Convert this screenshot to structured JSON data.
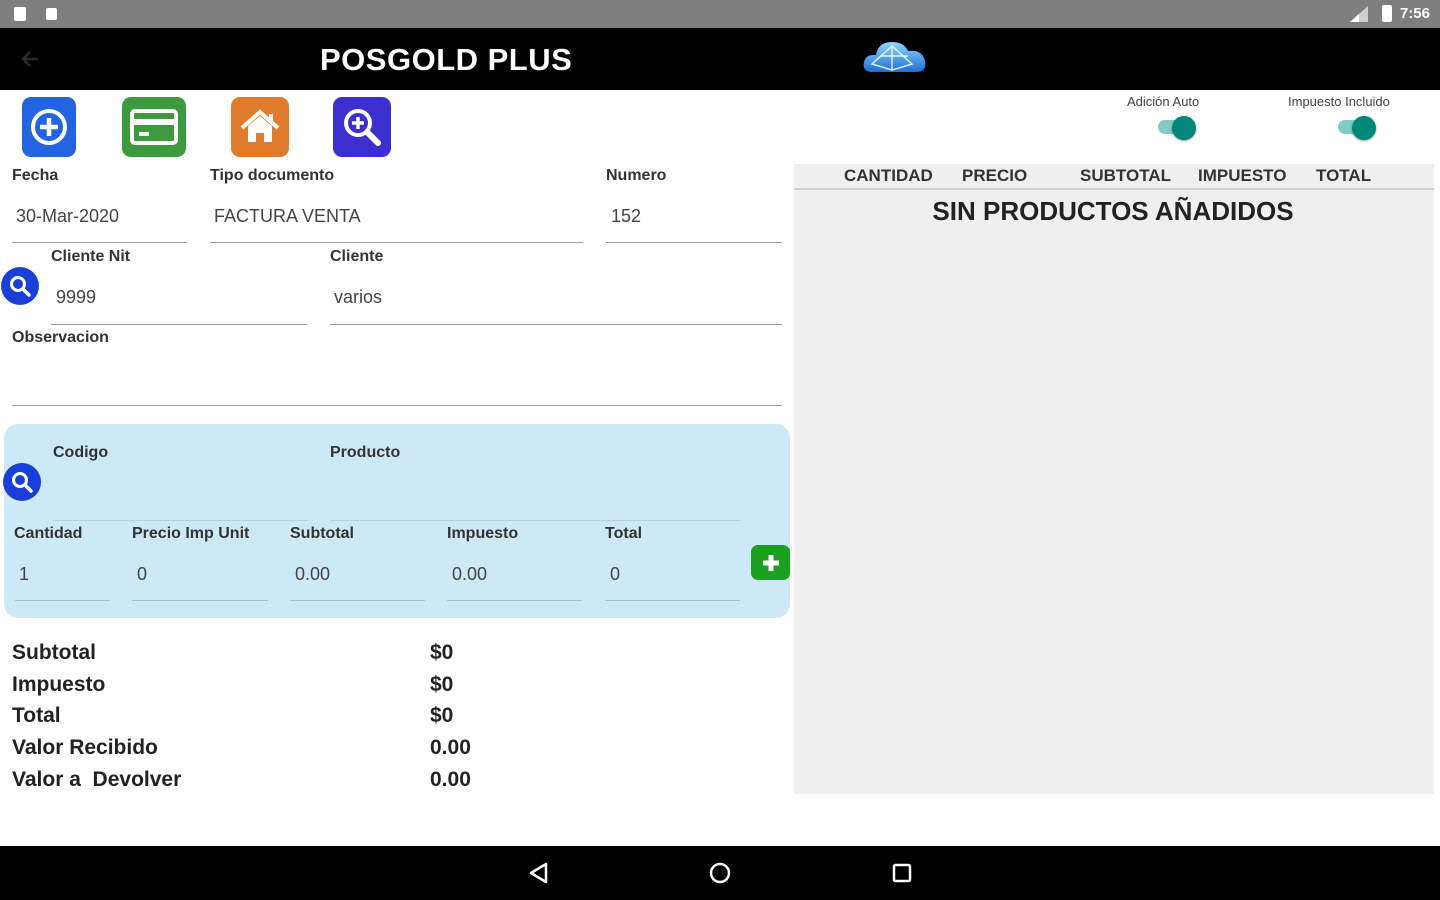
{
  "status_bar": {
    "time": "7:56"
  },
  "app_bar": {
    "title": "POSGOLD PLUS"
  },
  "toolbar": {
    "new_label": "new-document",
    "payment_label": "payment",
    "home_label": "home",
    "search_label": "search"
  },
  "switches": {
    "auto_add": {
      "label": "Adición Auto",
      "on": true
    },
    "tax_included": {
      "label": "Impuesto Incluido",
      "on": true
    }
  },
  "form": {
    "fecha": {
      "label": "Fecha",
      "value": "30-Mar-2020"
    },
    "tipo_documento": {
      "label": "Tipo documento",
      "value": "FACTURA VENTA"
    },
    "numero": {
      "label": "Numero",
      "value": "152"
    },
    "cliente_nit": {
      "label": "Cliente Nit",
      "value": "9999"
    },
    "cliente": {
      "label": "Cliente",
      "value": "varios"
    },
    "observacion": {
      "label": "Observacion",
      "value": ""
    }
  },
  "product_entry": {
    "codigo": {
      "label": "Codigo",
      "value": ""
    },
    "producto": {
      "label": "Producto",
      "value": ""
    },
    "cantidad": {
      "label": "Cantidad",
      "value": "1"
    },
    "precio_imp_unit": {
      "label": "Precio Imp Unit",
      "value": "0"
    },
    "subtotal": {
      "label": "Subtotal",
      "value": "0.00"
    },
    "impuesto": {
      "label": "Impuesto",
      "value": "0.00"
    },
    "total": {
      "label": "Total",
      "value": "0"
    }
  },
  "totals": [
    {
      "label": "Subtotal",
      "value": "$0"
    },
    {
      "label": "Impuesto",
      "value": "$0"
    },
    {
      "label": "Total",
      "value": "$0"
    },
    {
      "label": "Valor Recibido",
      "value": "0.00"
    },
    {
      "label": "Valor a  Devolver",
      "value": "0.00"
    }
  ],
  "items_table": {
    "columns": [
      "CANTIDAD",
      "PRECIO",
      "SUBTOTAL",
      "IMPUESTO",
      "TOTAL"
    ],
    "empty_message": "SIN PRODUCTOS AÑADIDOS"
  },
  "colors": {
    "accent_blue": "#1a3fd8",
    "switch_teal": "#00897b",
    "panel_blue": "#cde8f7",
    "add_green": "#1aa11f"
  }
}
